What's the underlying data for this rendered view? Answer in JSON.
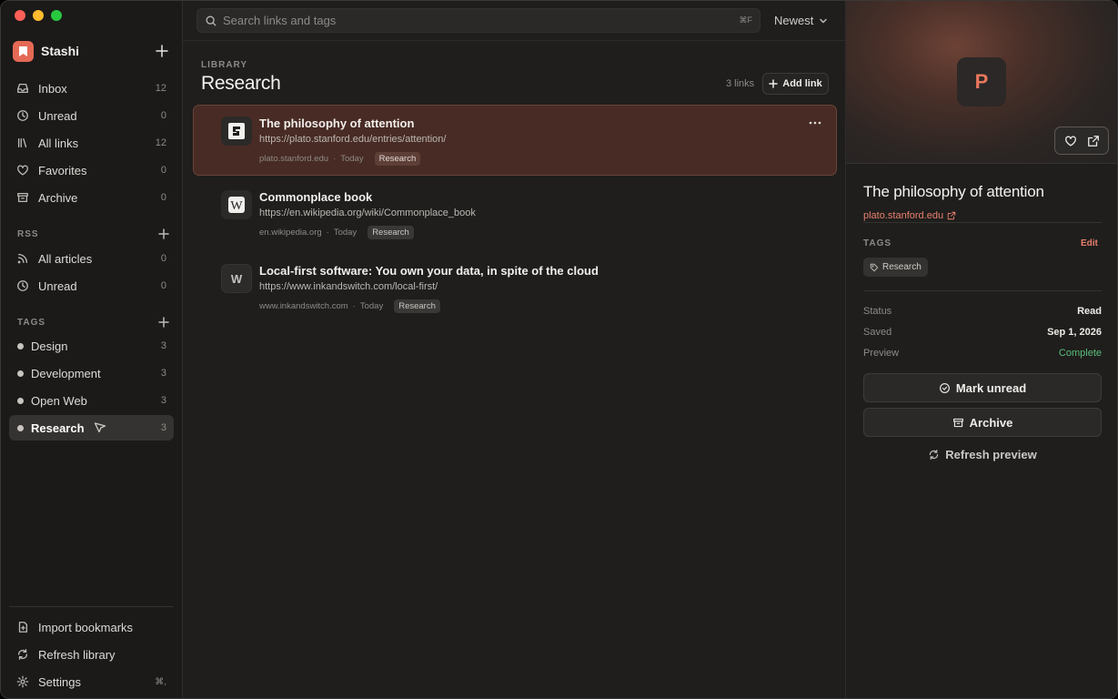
{
  "app": {
    "name": "Stashi"
  },
  "sidebar": {
    "main": [
      {
        "label": "Inbox",
        "count": "12",
        "icon": "inbox-icon"
      },
      {
        "label": "Unread",
        "count": "0",
        "icon": "clock-icon"
      },
      {
        "label": "All links",
        "count": "12",
        "icon": "library-icon"
      },
      {
        "label": "Favorites",
        "count": "0",
        "icon": "heart-icon"
      },
      {
        "label": "Archive",
        "count": "0",
        "icon": "archive-icon"
      }
    ],
    "rss_header": "RSS",
    "rss": [
      {
        "label": "All articles",
        "count": "0",
        "icon": "rss-icon"
      },
      {
        "label": "Unread",
        "count": "0",
        "icon": "clock-icon"
      }
    ],
    "tags_header": "TAGS",
    "tags": [
      {
        "label": "Design",
        "count": "3"
      },
      {
        "label": "Development",
        "count": "3"
      },
      {
        "label": "Open Web",
        "count": "3"
      },
      {
        "label": "Research",
        "count": "3",
        "active": true
      }
    ],
    "footer": [
      {
        "label": "Import bookmarks",
        "icon": "import-icon"
      },
      {
        "label": "Refresh library",
        "icon": "refresh-icon"
      },
      {
        "label": "Settings",
        "icon": "gear-icon",
        "shortcut": "⌘,"
      }
    ]
  },
  "search": {
    "placeholder": "Search links and tags",
    "shortcut": "⌘F"
  },
  "sort": {
    "label": "Newest"
  },
  "library": {
    "label": "LIBRARY",
    "title": "Research",
    "count": "3 links",
    "add_label": "Add link"
  },
  "links": [
    {
      "title": "The philosophy of attention",
      "url": "https://plato.stanford.edu/entries/attention/",
      "domain": "plato.stanford.edu",
      "date": "Today",
      "tag": "Research",
      "selected": true,
      "favicon": "sep-logo-icon"
    },
    {
      "title": "Commonplace book",
      "url": "https://en.wikipedia.org/wiki/Commonplace_book",
      "domain": "en.wikipedia.org",
      "date": "Today",
      "tag": "Research",
      "favicon": "wikipedia-icon"
    },
    {
      "title": "Local-first software: You own your data, in spite of the cloud",
      "url": "https://www.inkandswitch.com/local-first/",
      "domain": "www.inkandswitch.com",
      "date": "Today",
      "tag": "Research",
      "favicon_letter": "W"
    }
  ],
  "detail": {
    "hero_letter": "P",
    "title": "The philosophy of attention",
    "domain": "plato.stanford.edu",
    "tags_header": "TAGS",
    "edit_label": "Edit",
    "tag": "Research",
    "status_label": "Status",
    "status_value": "Read",
    "saved_label": "Saved",
    "saved_value": "Sep 1, 2026",
    "preview_label": "Preview",
    "preview_value": "Complete",
    "mark_unread_label": "Mark unread",
    "archive_label": "Archive",
    "refresh_label": "Refresh preview"
  },
  "colors": {
    "accent": "#e46a56",
    "selected_bg": "#482b24",
    "success": "#5bbf7a"
  }
}
